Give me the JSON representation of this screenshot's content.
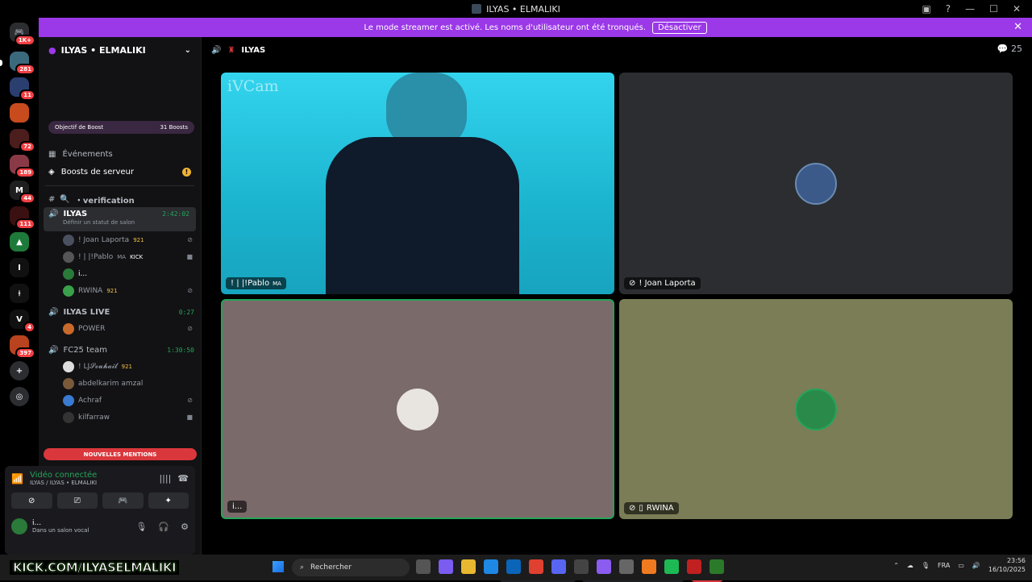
{
  "window": {
    "title": "ILYAS • ELMALIKI"
  },
  "banner": {
    "text": "Le mode streamer est activé. Les noms d'utilisateur ont été tronqués.",
    "button": "Désactiver"
  },
  "rail": {
    "badges": [
      "1K+",
      "281",
      "11",
      "72",
      "189",
      "44",
      "111",
      "4",
      "397"
    ],
    "letters": [
      "I",
      "V"
    ]
  },
  "guild": {
    "name": "ILYAS • ELMALIKI",
    "boost_goal": "Objectif de Boost",
    "boost_count": "31 Boosts"
  },
  "nav": {
    "events": "Événements",
    "boosts": "Boosts de serveur"
  },
  "channels": {
    "verification": "・verification",
    "active_voice": {
      "name": "ILYAS",
      "time": "2:42:02",
      "status": "Définir un statut de salon"
    },
    "members_active": [
      {
        "name": "! Joan Laporta",
        "tag": "921"
      },
      {
        "name": "! | |!Pablo",
        "suffix": "MA",
        "tag": "KICK"
      },
      {
        "name": "i..."
      },
      {
        "name": "RWINA",
        "tag": "921"
      }
    ],
    "live": {
      "name": "ILYAS LIVE",
      "time": "0:27"
    },
    "members_live": [
      {
        "name": "POWER"
      }
    ],
    "team": {
      "name": "FC25 team",
      "time": "1:30:50"
    },
    "members_team": [
      {
        "name": "! LJ𝓢𝓸𝓾𝓱𝓪𝓲𝓵",
        "tag": "921"
      },
      {
        "name": "abdelkarim amzal"
      },
      {
        "name": "Achraf"
      },
      {
        "name": "kilfarraw"
      }
    ],
    "new_mentions": "NOUVELLES MENTIONS"
  },
  "voice_panel": {
    "status": "Vidéo connectée",
    "location": "ILYAS / ILYAS • ELMALIKI",
    "me_name": "i...",
    "me_status": "Dans un salon vocal"
  },
  "stage": {
    "channel": "ILYAS",
    "count": "25",
    "watermark": "iVCam",
    "tiles": [
      {
        "label": "! | |!Pablo",
        "suffix": "MA"
      },
      {
        "label": "! Joan Laporta"
      },
      {
        "label": "i..."
      },
      {
        "label": "RWINA"
      }
    ]
  },
  "taskbar": {
    "kick_text": "KICK.COM/ILYASELMALIKI",
    "search": "Rechercher",
    "lang": "FRA",
    "time": "23:56",
    "date": "16/10/2025"
  },
  "colors": {
    "banner": "#9b38e8",
    "green": "#23a55a",
    "red": "#da373c",
    "leave": "#da373c"
  }
}
